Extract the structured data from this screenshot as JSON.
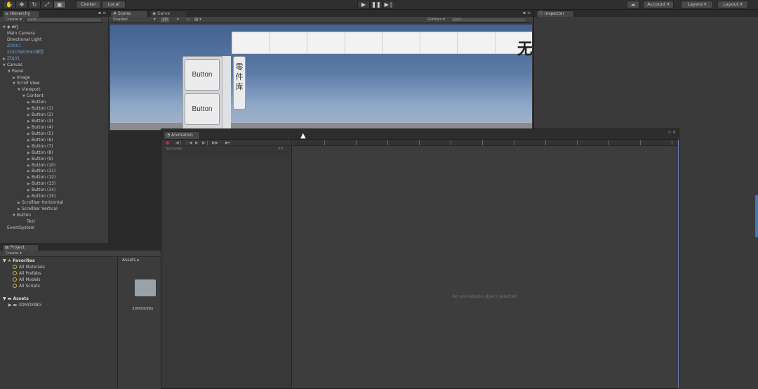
{
  "toolbar": {
    "tools": [
      "hand-icon",
      "move-icon",
      "rotate-icon",
      "scale-icon",
      "rect-icon"
    ],
    "pivot_label": "Center",
    "space_label": "Local",
    "play_glyph": "▶",
    "pause_glyph": "❚❚",
    "step_glyph": "▶❘",
    "account_label": "Account",
    "layers_label": "Layers",
    "layout_label": "Layout"
  },
  "hierarchy": {
    "tab": "Hierarchy",
    "create_label": "Create",
    "search_placeholder": "Q▾All",
    "scene": "wrj",
    "items": [
      {
        "label": "Main Camera",
        "indent": 1,
        "arrow": ""
      },
      {
        "label": "Directional Light",
        "indent": 1,
        "arrow": ""
      },
      {
        "label": "ZD001",
        "indent": 1,
        "arrow": "",
        "blue": true
      },
      {
        "label": "SOLIDWORKS模型",
        "indent": 1,
        "arrow": "",
        "blue": true
      },
      {
        "label": "ZDJ01",
        "indent": 1,
        "arrow": "▶",
        "blue": true
      },
      {
        "label": "Canvas",
        "indent": 1,
        "arrow": "▼"
      },
      {
        "label": "Panel",
        "indent": 2,
        "arrow": "▼"
      },
      {
        "label": "Image",
        "indent": 3,
        "arrow": "▶"
      },
      {
        "label": "Scroll View",
        "indent": 3,
        "arrow": "▼"
      },
      {
        "label": "Viewport",
        "indent": 4,
        "arrow": "▼"
      },
      {
        "label": "Content",
        "indent": 5,
        "arrow": "▼"
      },
      {
        "label": "Button",
        "indent": 6,
        "arrow": "▶"
      },
      {
        "label": "Button (1)",
        "indent": 6,
        "arrow": "▶"
      },
      {
        "label": "Button (2)",
        "indent": 6,
        "arrow": "▶"
      },
      {
        "label": "Button (3)",
        "indent": 6,
        "arrow": "▶"
      },
      {
        "label": "Button (4)",
        "indent": 6,
        "arrow": "▶"
      },
      {
        "label": "Button (5)",
        "indent": 6,
        "arrow": "▶"
      },
      {
        "label": "Button (6)",
        "indent": 6,
        "arrow": "▶"
      },
      {
        "label": "Button (7)",
        "indent": 6,
        "arrow": "▶"
      },
      {
        "label": "Button (8)",
        "indent": 6,
        "arrow": "▶"
      },
      {
        "label": "Button (9)",
        "indent": 6,
        "arrow": "▶"
      },
      {
        "label": "Button (10)",
        "indent": 6,
        "arrow": "▶"
      },
      {
        "label": "Button (11)",
        "indent": 6,
        "arrow": "▶"
      },
      {
        "label": "Button (12)",
        "indent": 6,
        "arrow": "▶"
      },
      {
        "label": "Button (13)",
        "indent": 6,
        "arrow": "▶"
      },
      {
        "label": "Button (14)",
        "indent": 6,
        "arrow": "▶"
      },
      {
        "label": "Button (15)",
        "indent": 6,
        "arrow": "▶"
      },
      {
        "label": "Scrollbar Horizontal",
        "indent": 4,
        "arrow": "▶"
      },
      {
        "label": "Scrollbar Vertical",
        "indent": 4,
        "arrow": "▶"
      },
      {
        "label": "Button",
        "indent": 3,
        "arrow": "▼"
      },
      {
        "label": "Text",
        "indent": 5,
        "arrow": ""
      },
      {
        "label": "EventSystem",
        "indent": 1,
        "arrow": ""
      }
    ]
  },
  "scene": {
    "tab_scene": "Scene",
    "tab_game": "Game",
    "shading": "Shaded",
    "mode_2d": "2D",
    "gizmos": "Gizmos",
    "search_placeholder": "Q▾All",
    "button_label": "Button",
    "vertical_label": "零件库",
    "title_char": "无"
  },
  "animation": {
    "tab": "Animation",
    "samples_label": "Samples",
    "samples_value": "60",
    "empty_message": "No animatable object selected."
  },
  "project": {
    "tab": "Project",
    "create_label": "Create",
    "favorites_label": "Favorites",
    "favorites": [
      "All Materials",
      "All Prefabs",
      "All Models",
      "All Scripts"
    ],
    "assets_label": "Assets",
    "assets_children": [
      "3DMOXING"
    ],
    "breadcrumb": "Assets",
    "folder_name": "3DMOXING"
  },
  "inspector": {
    "tab": "Inspector"
  }
}
